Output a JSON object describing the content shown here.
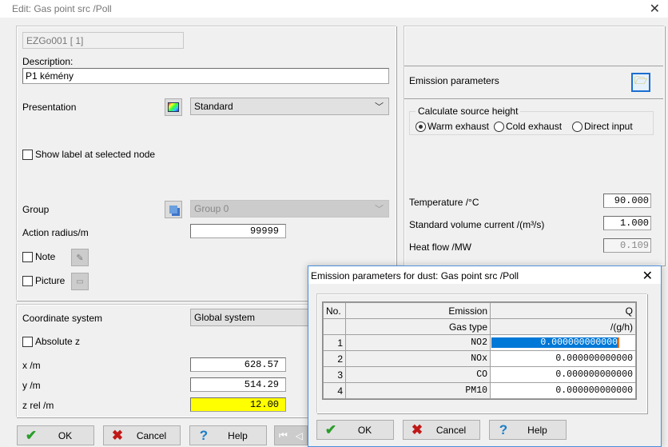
{
  "window": {
    "title": "Edit:  Gas point src /Poll"
  },
  "left": {
    "id_field": "EZGo001  [  1]",
    "description_label": "Description:",
    "description_value": "P1 kémény",
    "presentation_label": "Presentation",
    "presentation_value": "Standard",
    "show_label": "Show label at selected node",
    "group_label": "Group",
    "group_value": "Group 0",
    "action_radius_label": "Action radius/m",
    "action_radius_value": "99999",
    "note_label": "Note",
    "picture_label": "Picture",
    "coord_label": "Coordinate system",
    "coord_value": "Global system",
    "absolute_z_label": "Absolute z",
    "x_label": "x /m",
    "x_value": "628.57",
    "y_label": "y /m",
    "y_value": "514.29",
    "z_label": "z rel /m",
    "z_value": "12.00",
    "z_highlight": "#ffff00"
  },
  "right": {
    "emission_label": "Emission parameters",
    "source_height_legend": "Calculate source height",
    "radios": [
      {
        "label": "Warm exhaust",
        "selected": true
      },
      {
        "label": "Cold exhaust",
        "selected": false
      },
      {
        "label": "Direct input",
        "selected": false
      }
    ],
    "temperature_label": "Temperature /°C",
    "temperature_value": "90.000",
    "volume_label": "Standard volume current /(m³/s)",
    "volume_value": "1.000",
    "heat_label": "Heat flow /MW",
    "heat_value": "0.109"
  },
  "buttons": {
    "ok": "OK",
    "cancel": "Cancel",
    "help": "Help"
  },
  "sub": {
    "title": "Emission parameters for dust:  Gas point src /Poll",
    "headers": [
      "No.",
      "Emission",
      "Q"
    ],
    "subheaders": [
      "",
      "Gas type",
      "/(g/h)"
    ],
    "rows": [
      {
        "no": "1",
        "gas": "NO2",
        "q": "0.000000000000"
      },
      {
        "no": "2",
        "gas": "NOx",
        "q": "0.000000000000"
      },
      {
        "no": "3",
        "gas": "CO",
        "q": "0.000000000000"
      },
      {
        "no": "4",
        "gas": "PM10",
        "q": "0.000000000000"
      }
    ],
    "selection_color": "#0078d7",
    "ok": "OK",
    "cancel": "Cancel",
    "help": "Help"
  }
}
